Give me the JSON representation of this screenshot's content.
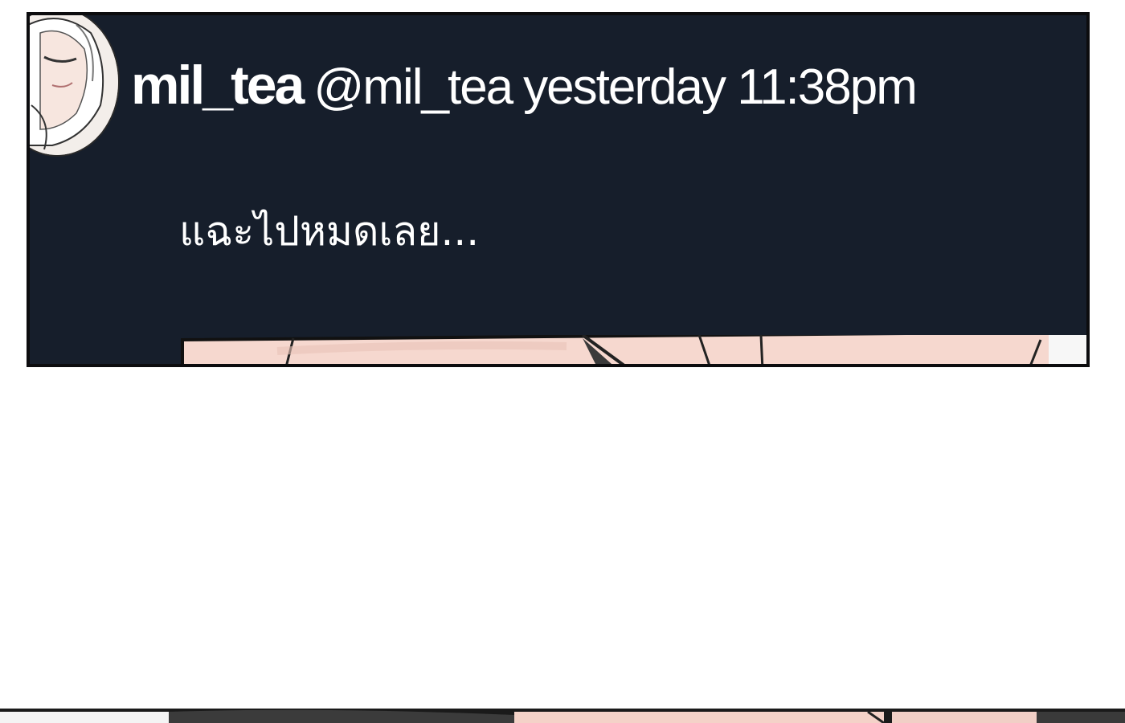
{
  "post": {
    "display_name": "mil_tea",
    "handle": "@mil_tea",
    "timestamp": "yesterday 11:38pm",
    "message": "แฉะไปหมดเลย..."
  },
  "colors": {
    "panel_bg": "#161e2b",
    "text": "#ffffff",
    "skin": "#f6d8cf"
  },
  "icons": {
    "avatar": "avatar-illustration"
  }
}
